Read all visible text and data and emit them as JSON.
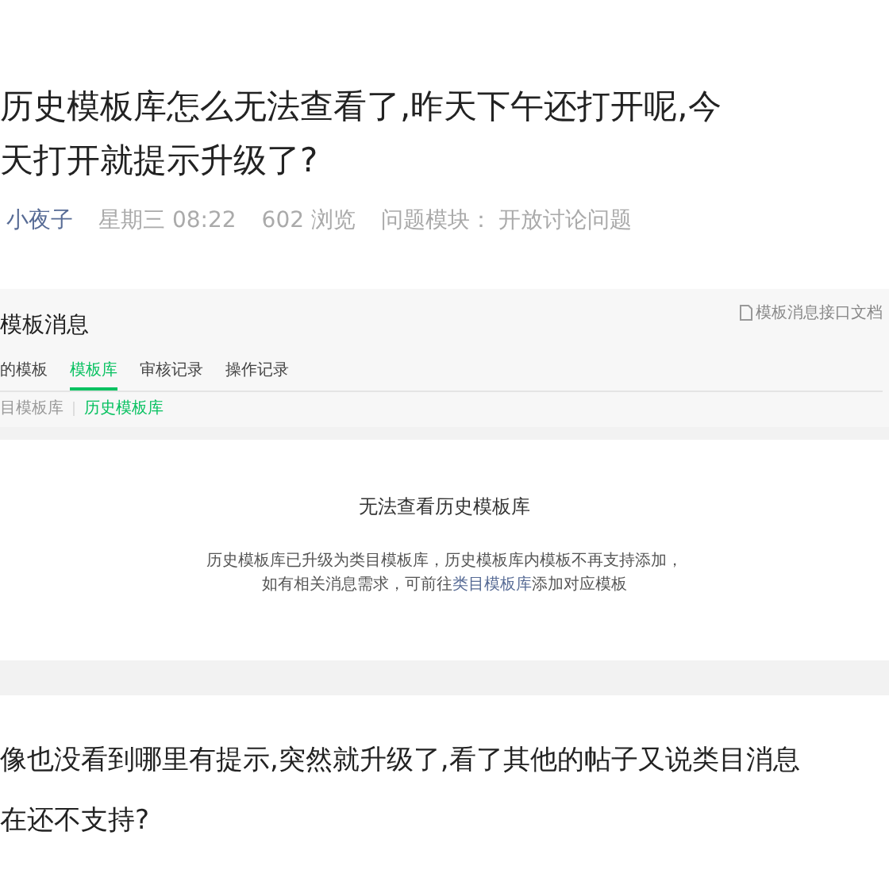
{
  "post": {
    "title_lines": [
      "历史模板库怎么无法查看了,昨天下午还打开呢,今",
      "天打开就提示升级了?"
    ],
    "meta": {
      "author": "小夜子",
      "time": "星期三 08:22",
      "views": "602 浏览",
      "module_label": "问题模块：",
      "module": "开放讨论问题"
    },
    "screenshot": {
      "title": "模板消息",
      "doc_link": "模板消息接口文档",
      "tabs": [
        {
          "label": "的模板",
          "selected": false
        },
        {
          "label": "模板库",
          "selected": true
        },
        {
          "label": "审核记录",
          "selected": false
        },
        {
          "label": "操作记录",
          "selected": false
        }
      ],
      "subtabs": [
        {
          "label": "目模板库",
          "selected": false
        },
        {
          "label": "历史模板库",
          "selected": true
        }
      ],
      "notice": {
        "heading": "无法查看历史模板库",
        "line_1": "历史模板库已升级为类目模板库，历史模板库内模板不再支持添加，",
        "line_2_before": "如有相关消息需求，可前往",
        "line_2_link": "类目模板库",
        "line_2_after": "添加对应模板"
      }
    },
    "body_lines": [
      "像也没看到哪里有提示,突然就升级了,看了其他的帖子又说类目消息",
      "在还不支持?"
    ]
  }
}
